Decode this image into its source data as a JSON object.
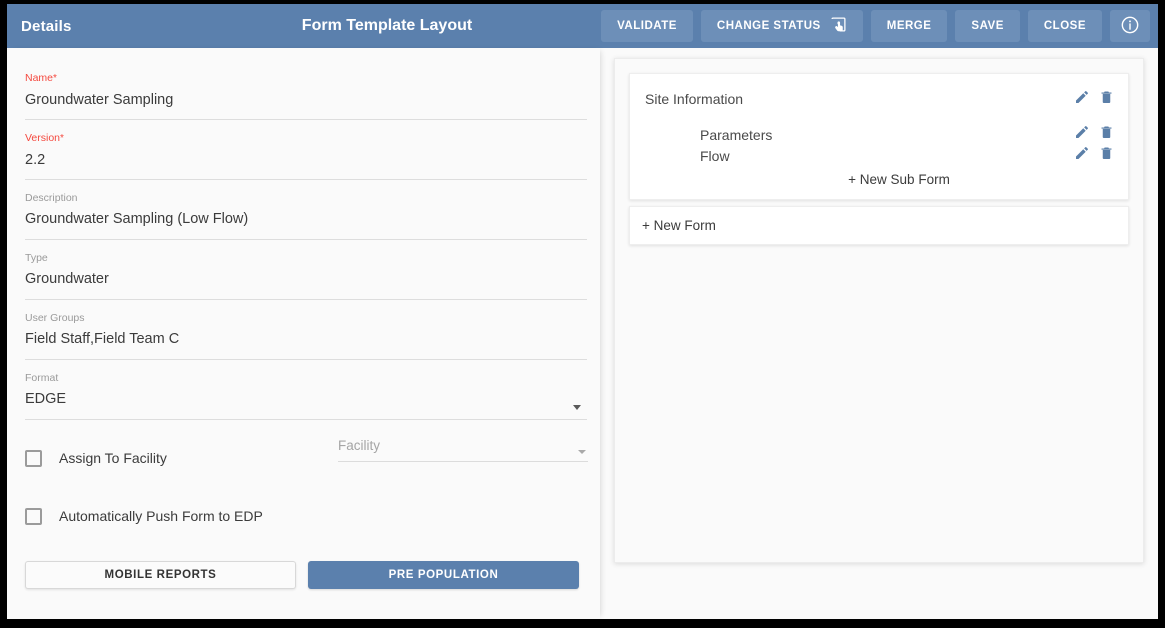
{
  "header": {
    "left_title": "Details",
    "title": "Form Template Layout",
    "actions": [
      {
        "label": "VALIDATE",
        "icon": null
      },
      {
        "label": "CHANGE STATUS",
        "icon": "tap-app-icon"
      },
      {
        "label": "MERGE",
        "icon": null
      },
      {
        "label": "SAVE",
        "icon": null
      },
      {
        "label": "CLOSE",
        "icon": null
      }
    ],
    "info_icon": "info-circle-icon",
    "bg_color": "#5b80ad",
    "button_color": "#6d8fb8"
  },
  "details_form": {
    "fields": [
      {
        "label": "Name",
        "required": true,
        "value": "Groundwater Sampling"
      },
      {
        "label": "Version",
        "required": true,
        "value": "2.2"
      },
      {
        "label": "Description",
        "required": false,
        "value": "Groundwater Sampling (Low Flow)"
      },
      {
        "label": "Type",
        "required": false,
        "value": "Groundwater"
      },
      {
        "label": "User Groups",
        "required": false,
        "value": "Field Staff,Field Team C"
      },
      {
        "label": "Format",
        "required": false,
        "value": "EDGE",
        "dropdown": true
      }
    ],
    "checkboxes": [
      {
        "label": "Assign To Facility",
        "checked": false
      },
      {
        "label": "Automatically Push Form to EDP",
        "checked": false
      }
    ],
    "facility_select": {
      "placeholder": "Facility",
      "value": ""
    },
    "buttons": {
      "mobile_reports": "MOBILE REPORTS",
      "pre_population": "PRE POPULATION"
    },
    "required_color": "#f4493f",
    "accent_color": "#5b80ad"
  },
  "layout_panel": {
    "form": {
      "name": "Site Information",
      "edit_icon": "pencil-icon",
      "delete_icon": "trash-icon",
      "subforms": [
        {
          "name": "Parameters",
          "edit_icon": "pencil-icon",
          "delete_icon": "trash-icon"
        },
        {
          "name": "Flow",
          "edit_icon": "pencil-icon",
          "delete_icon": "trash-icon"
        }
      ],
      "new_sub_form_label": "+ New Sub Form"
    },
    "new_form_label": "+ New Form",
    "icon_color": "#5b7fa8"
  }
}
